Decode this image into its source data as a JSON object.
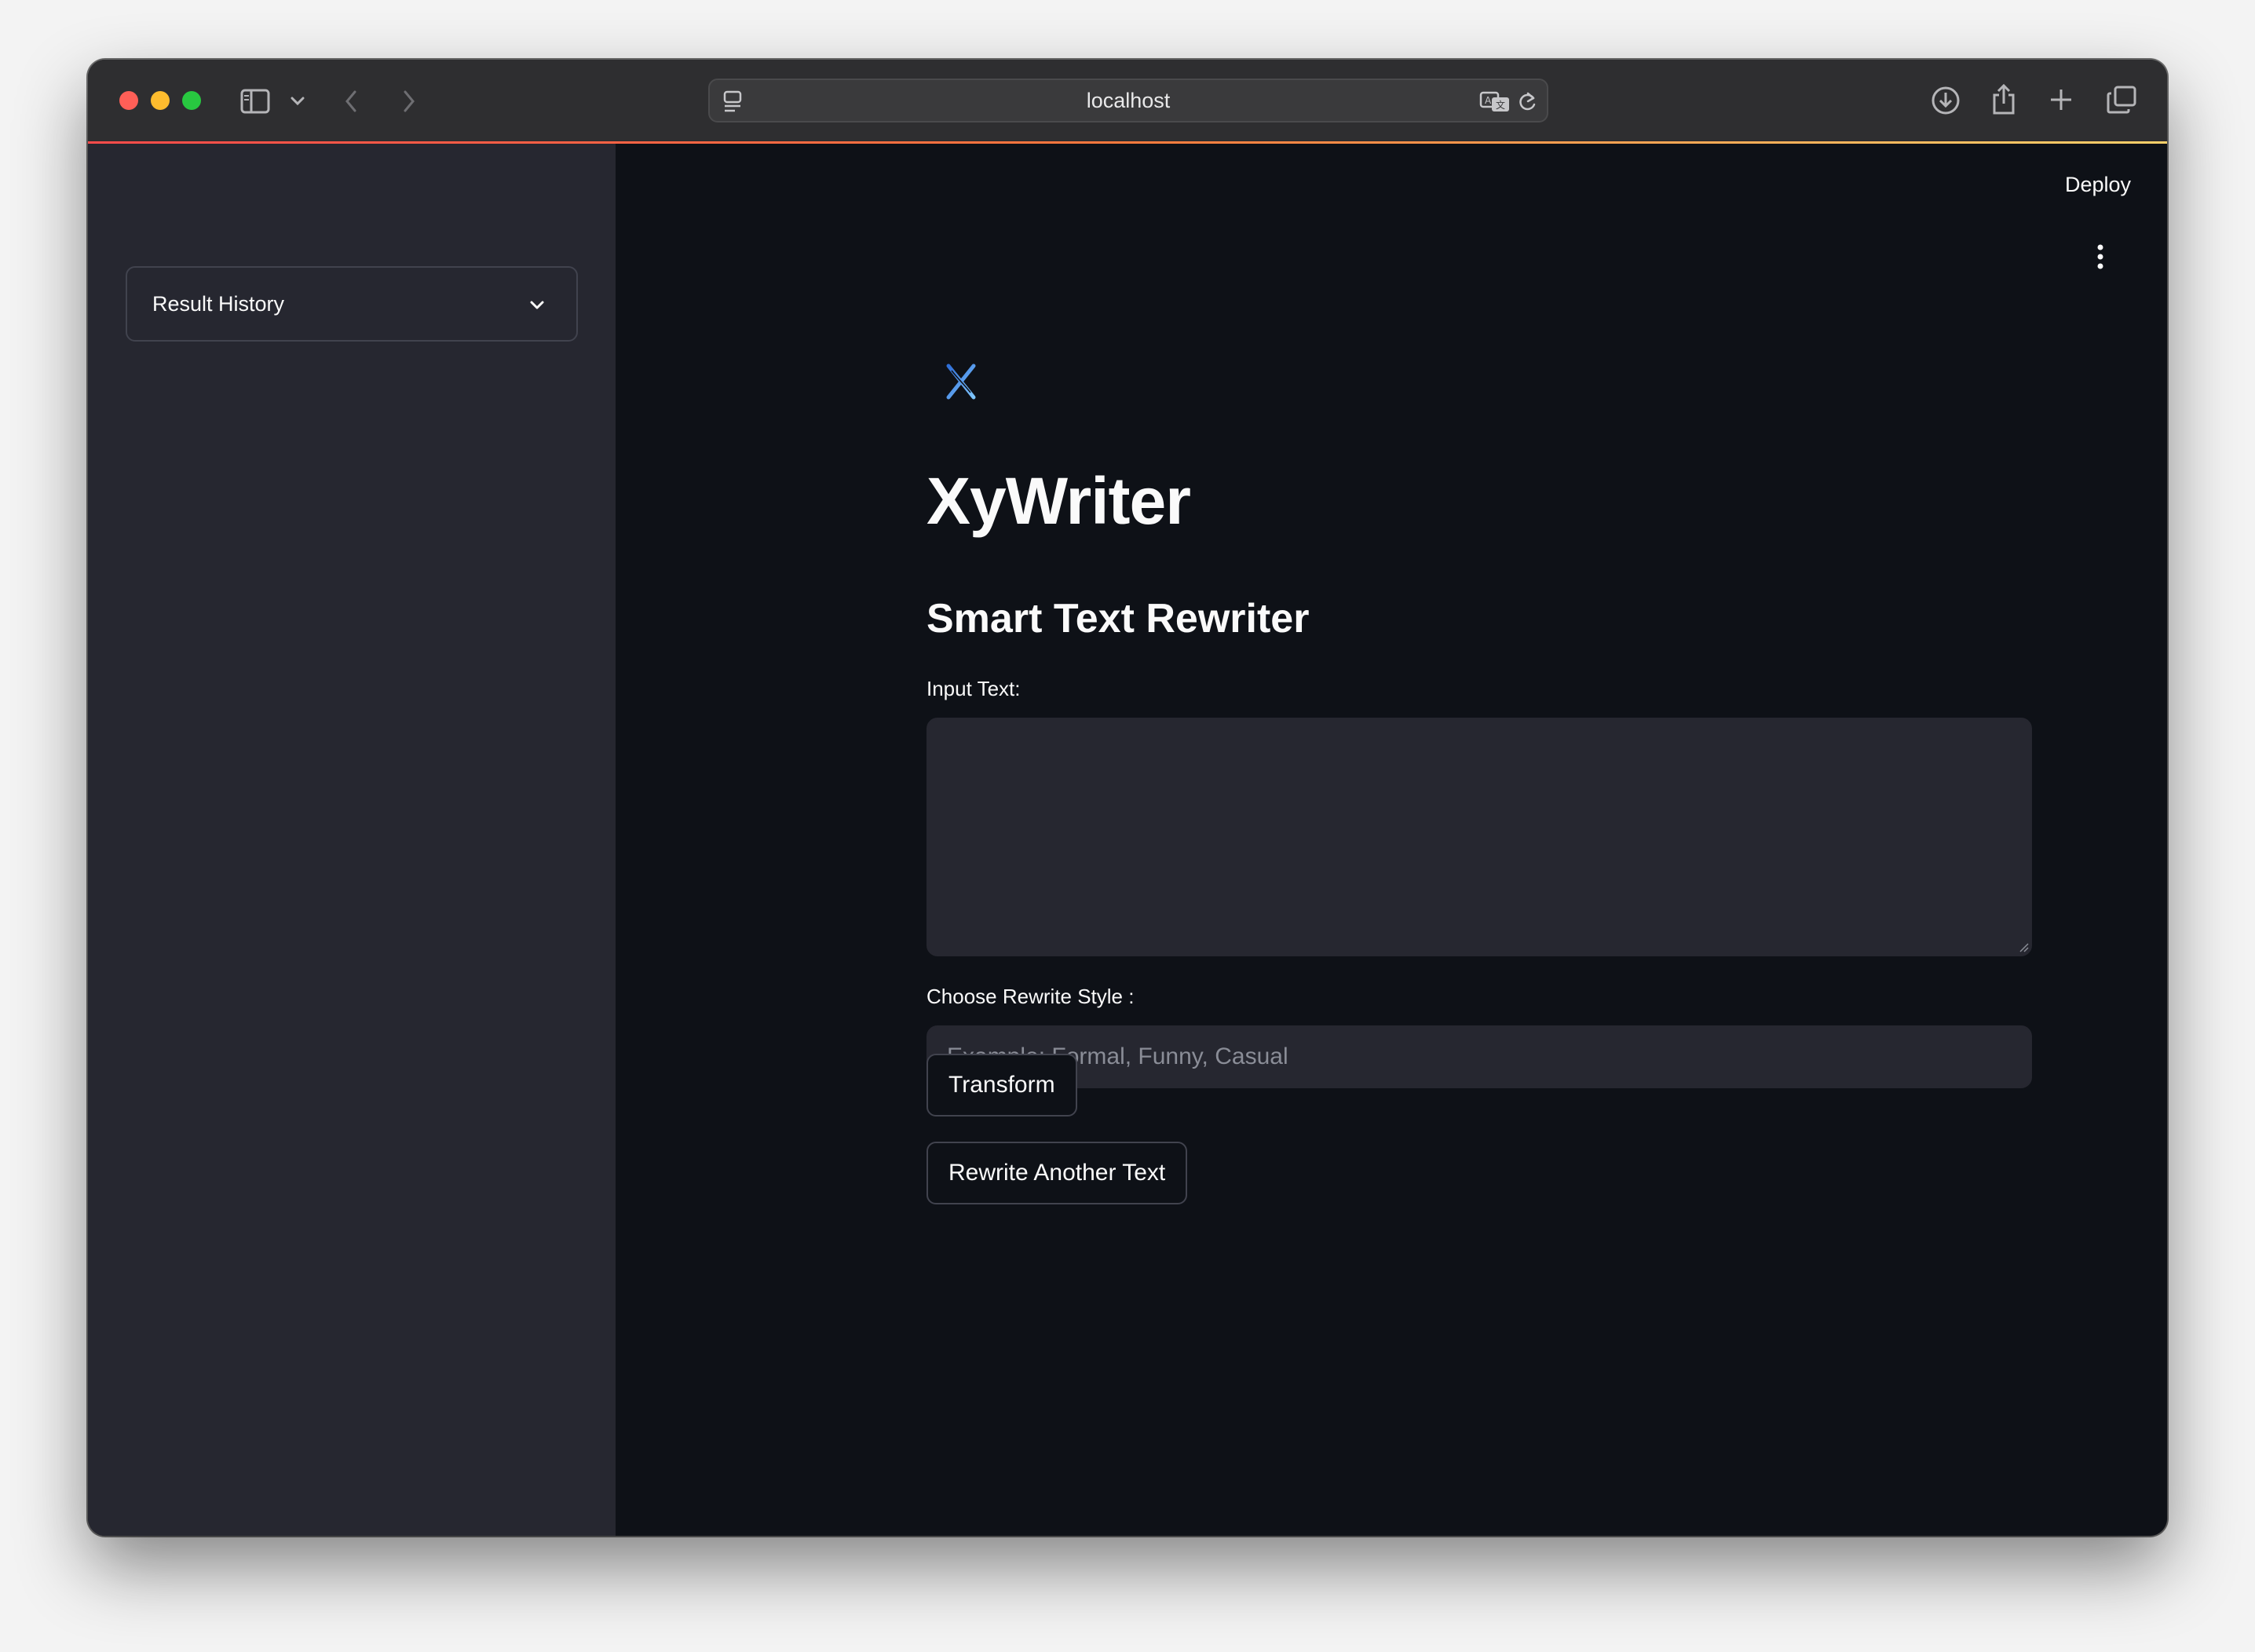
{
  "browser": {
    "url": "localhost",
    "icons": {
      "sidebar_toggle": "sidebar-icon",
      "tab_menu": "chevron-down-icon",
      "back": "chevron-left-icon",
      "forward": "chevron-right-icon",
      "site_settings": "page-menu-icon",
      "translate": "translate-icon",
      "reload": "reload-icon",
      "downloads": "download-icon",
      "share": "share-icon",
      "new_tab": "plus-icon",
      "tab_overview": "tabs-icon"
    },
    "colors": {
      "close": "#ff5f57",
      "minimize": "#febc2e",
      "zoom": "#28c840"
    }
  },
  "sidebar": {
    "history_label": "Result History"
  },
  "header": {
    "deploy_label": "Deploy"
  },
  "main": {
    "title": "XyWriter",
    "subtitle": "Smart Text Rewriter",
    "input_label": "Input Text:",
    "input_value": "",
    "style_label": "Choose Rewrite Style :",
    "style_placeholder": "Example: Formal, Funny, Casual",
    "style_value": "",
    "transform_label": "Transform",
    "rewrite_label": "Rewrite Another Text"
  },
  "theme": {
    "main_bg": "#0e1117",
    "sidebar_bg": "#262730",
    "text": "#fafafa",
    "accent": "#ff4b4b",
    "logo_color": "#4aa3ff"
  }
}
